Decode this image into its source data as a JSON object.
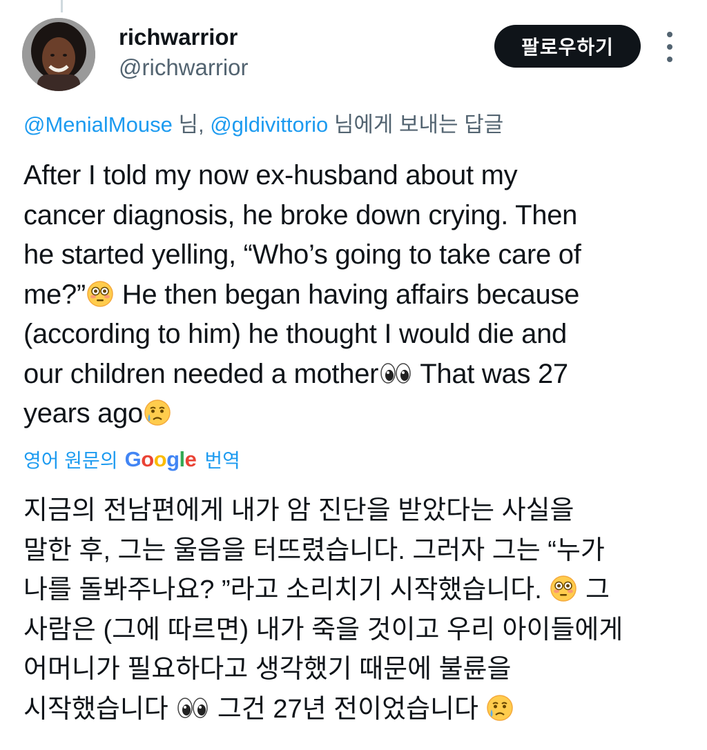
{
  "author": {
    "display_name": "richwarrior",
    "handle": "@richwarrior",
    "avatar_icon": "profile-photo"
  },
  "header": {
    "follow_label": "팔로우하기",
    "more_icon": "more-options-icon"
  },
  "reply_context": {
    "mentions": [
      "@MenialMouse",
      "@gldivittorio"
    ],
    "suffix_1": " 님, ",
    "suffix_2": " 님에게 보내는 답글"
  },
  "tweet": {
    "lines": [
      "After I told my now ex-husband about my",
      "cancer diagnosis, he broke down crying. Then",
      "he started yelling, “Who’s going to take care of",
      "me?”",
      " He then began having affairs because",
      "(according to him) he thought I would die and",
      "our children needed a mother",
      " That was 27",
      "years ago"
    ]
  },
  "translate": {
    "prefix": "영어 원문의",
    "google_letters": [
      "G",
      "o",
      "o",
      "g",
      "l",
      "e"
    ],
    "suffix": "번역",
    "colors": {
      "blue": "#4285f4",
      "red": "#ea4335",
      "yellow": "#fbbc05",
      "green": "#34a853"
    }
  },
  "translation": {
    "lines": [
      "지금의 전남편에게 내가 암 진단을 받았다는 사실을",
      "말한 후, 그는 울음을 터뜨렸습니다. 그러자 그는 “누가",
      "나를 돌봐주나요? ”라고 소리치기 시작했습니다. ",
      " 그",
      "사람은 (그에 따르면) 내가 죽을 것이고 우리 아이들에게",
      "어머니가 필요하다고 생각했기 때문에 불륜을",
      "시작했습니다 ",
      " 그건 27년 전이었습니다 "
    ]
  },
  "emojis": {
    "flushed": "flushed-face-icon",
    "eyes": "eyes-icon",
    "crying": "crying-face-icon"
  },
  "colors": {
    "text": "#0f1419",
    "secondary": "#536471",
    "link": "#1d9bf0",
    "button": "#0f1419"
  }
}
